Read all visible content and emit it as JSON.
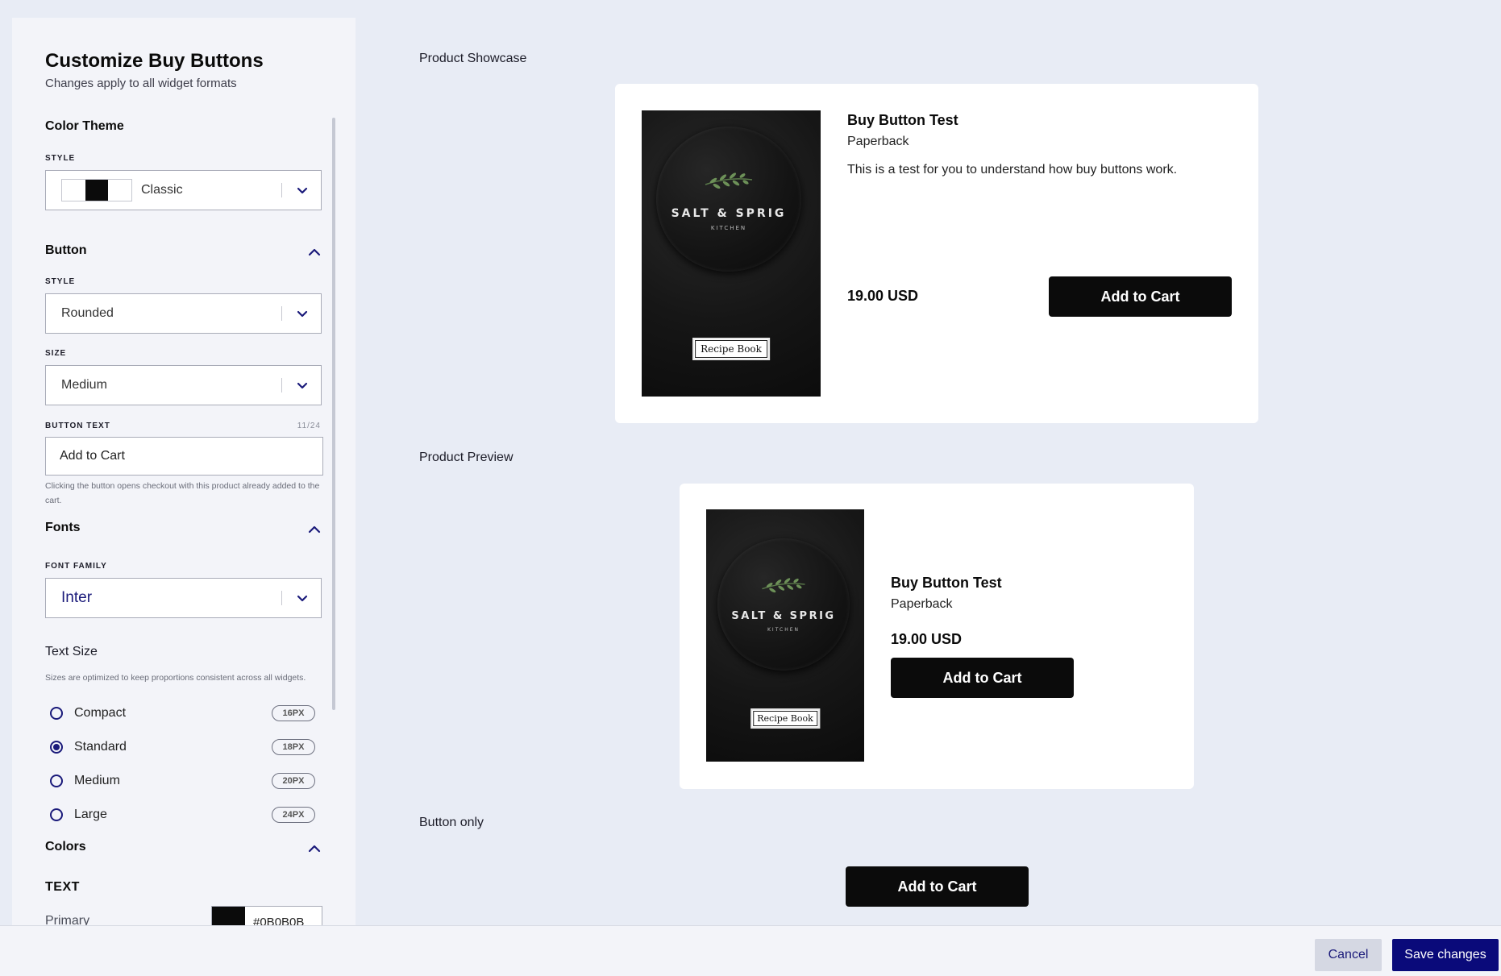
{
  "sidebar": {
    "title": "Customize Buy Buttons",
    "subtitle": "Changes apply to all widget formats",
    "color_theme": {
      "section_title": "Color Theme",
      "style_label": "STYLE",
      "style_value": "Classic",
      "swatches": [
        "#ffffff",
        "#0b0b0b",
        "#ffffff"
      ]
    },
    "button": {
      "section_title": "Button",
      "style_label": "STYLE",
      "style_value": "Rounded",
      "size_label": "SIZE",
      "size_value": "Medium",
      "text_label": "BUTTON TEXT",
      "text_counter": "11/24",
      "text_value": "Add to Cart",
      "helper": "Clicking the button opens checkout with this product already added to the cart."
    },
    "fonts": {
      "section_title": "Fonts",
      "family_label": "FONT FAMILY",
      "family_value": "Inter",
      "text_size_title": "Text Size",
      "text_size_sub": "Sizes are optimized to keep proportions consistent across all widgets.",
      "sizes": [
        {
          "label": "Compact",
          "badge": "16PX",
          "selected": false
        },
        {
          "label": "Standard",
          "badge": "18PX",
          "selected": true
        },
        {
          "label": "Medium",
          "badge": "20PX",
          "selected": false
        },
        {
          "label": "Large",
          "badge": "24PX",
          "selected": false
        }
      ]
    },
    "colors": {
      "section_title": "Colors",
      "text_label": "TEXT",
      "primary_label": "Primary",
      "primary_value": "#0B0B0B",
      "primary_color": "#0b0b0b"
    }
  },
  "book": {
    "brand": "SALT & SPRIG",
    "brand_sub": "KITCHEN",
    "tag": "Recipe Book"
  },
  "showcase": {
    "label": "Product Showcase",
    "title": "Buy Button Test",
    "type": "Paperback",
    "description": "This is a test for you to understand how buy buttons work.",
    "price": "19.00 USD",
    "cta": "Add to Cart"
  },
  "preview": {
    "label": "Product Preview",
    "title": "Buy Button Test",
    "type": "Paperback",
    "price": "19.00 USD",
    "cta": "Add to Cart"
  },
  "button_only": {
    "label": "Button only",
    "cta": "Add to Cart"
  },
  "footer": {
    "cancel": "Cancel",
    "save": "Save changes"
  },
  "colors": {
    "accent": "#0a0a7a",
    "cta_bg": "#0b0b0b",
    "page_bg": "#e8ecf5"
  }
}
